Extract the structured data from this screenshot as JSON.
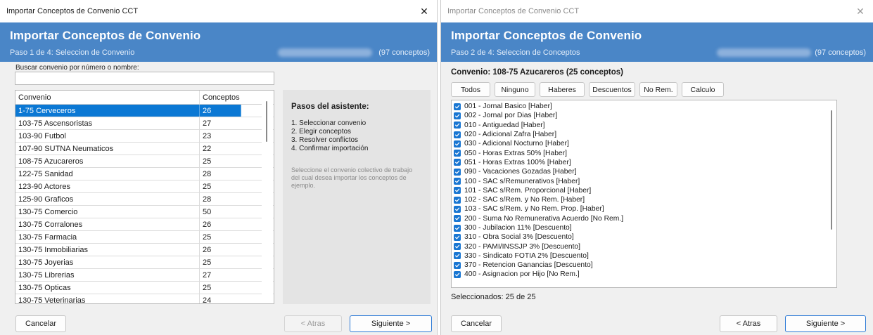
{
  "left": {
    "window_title": "Importar Conceptos de Convenio CCT",
    "close_glyph": "✕",
    "header_title": "Importar Conceptos de Convenio",
    "header_step": "Paso 1 de 4: Seleccion de Convenio",
    "header_count": "(97 conceptos)",
    "search_label": "Buscar convenio por número o nombre:",
    "search_value": "",
    "grid_headers": [
      "Convenio",
      "Conceptos"
    ],
    "rows": [
      {
        "name": "1-75 Cerveceros",
        "count": "26"
      },
      {
        "name": "103-75 Ascensoristas",
        "count": "27"
      },
      {
        "name": "103-90 Futbol",
        "count": "23"
      },
      {
        "name": "107-90 SUTNA Neumaticos",
        "count": "22"
      },
      {
        "name": "108-75 Azucareros",
        "count": "25"
      },
      {
        "name": "122-75 Sanidad",
        "count": "28"
      },
      {
        "name": "123-90 Actores",
        "count": "25"
      },
      {
        "name": "125-90 Graficos",
        "count": "28"
      },
      {
        "name": "130-75 Comercio",
        "count": "50"
      },
      {
        "name": "130-75 Corralones",
        "count": "26"
      },
      {
        "name": "130-75 Farmacia",
        "count": "25"
      },
      {
        "name": "130-75 Inmobiliarias",
        "count": "26"
      },
      {
        "name": "130-75 Joyerias",
        "count": "25"
      },
      {
        "name": "130-75 Librerias",
        "count": "27"
      },
      {
        "name": "130-75 Opticas",
        "count": "25"
      },
      {
        "name": "130-75 Veterinarias",
        "count": "24"
      }
    ],
    "steps_title": "Pasos del asistente:",
    "steps": [
      "1. Seleccionar convenio",
      "2. Elegir conceptos",
      "3. Resolver conflictos",
      "4. Confirmar importación"
    ],
    "steps_help": "Seleccione el convenio colectivo de trabajo del cual desea importar los conceptos de ejemplo.",
    "btn_cancel": "Cancelar",
    "btn_back": "< Atras",
    "btn_next": "Siguiente >"
  },
  "right": {
    "window_title": "Importar Conceptos de Convenio CCT",
    "close_glyph": "✕",
    "header_title": "Importar Conceptos de Convenio",
    "header_step": "Paso 2 de 4: Seleccion de Conceptos",
    "header_count": "(97 conceptos)",
    "convenio_title": "Convenio: 108-75 Azucareros (25 conceptos)",
    "filters": [
      "Todos",
      "Ninguno",
      "Haberes",
      "Descuentos",
      "No Rem.",
      "Calculo"
    ],
    "concepts": [
      "001 - Jornal Basico [Haber]",
      "002 - Jornal por Dias [Haber]",
      "010 - Antiguedad [Haber]",
      "020 - Adicional Zafra [Haber]",
      "030 - Adicional Nocturno [Haber]",
      "050 - Horas Extras 50% [Haber]",
      "051 - Horas Extras 100% [Haber]",
      "090 - Vacaciones Gozadas [Haber]",
      "100 - SAC s/Remunerativos [Haber]",
      "101 - SAC s/Rem. Proporcional [Haber]",
      "102 - SAC s/Rem. y No Rem. [Haber]",
      "103 - SAC s/Rem. y No Rem. Prop. [Haber]",
      "200 - Suma No Remunerativa Acuerdo [No Rem.]",
      "300 - Jubilacion 11% [Descuento]",
      "310 - Obra Social 3% [Descuento]",
      "320 - PAMI/INSSJP 3% [Descuento]",
      "330 - Sindicato FOTIA 2% [Descuento]",
      "370 - Retencion Ganancias [Descuento]",
      "400 - Asignacion por Hijo [No Rem.]"
    ],
    "selected_text": "Seleccionados: 25 de 25",
    "btn_cancel": "Cancelar",
    "btn_back": "< Atras",
    "btn_next": "Siguiente >"
  },
  "colors": {
    "header_bg": "#4a86c7",
    "selection": "#0b78d4",
    "checkbox": "#1976d2",
    "primary_border": "#2c7ad6"
  }
}
